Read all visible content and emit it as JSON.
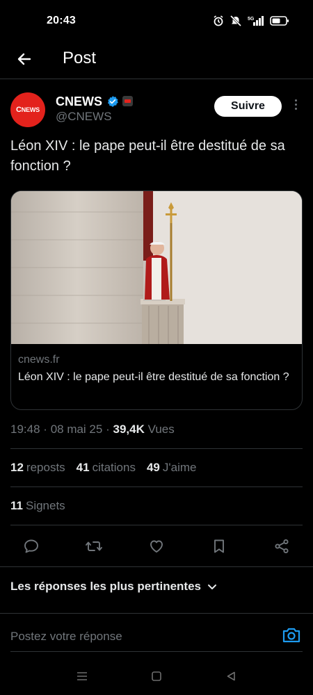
{
  "status_bar": {
    "time": "20:43",
    "network": "5G"
  },
  "header": {
    "title": "Post"
  },
  "author": {
    "name": "CNEWS",
    "handle": "@CNEWS",
    "avatar_text": "NEWS",
    "avatar_letter": "C",
    "verified": true,
    "follow_label": "Suivre"
  },
  "tweet": {
    "text": "Léon XIV : le pape peut-il être destitué de sa fonction ?"
  },
  "card": {
    "domain": "cnews.fr",
    "title": "Léon XIV : le pape peut-il être destitué de sa fonction ?"
  },
  "meta": {
    "time": "19:48",
    "date": "08 mai 25",
    "views_count": "39,4K",
    "views_label": "Vues",
    "separator": "·"
  },
  "stats": {
    "reposts_count": "12",
    "reposts_label": "reposts",
    "quotes_count": "41",
    "quotes_label": "citations",
    "likes_count": "49",
    "likes_label": "J'aime",
    "bookmarks_count": "11",
    "bookmarks_label": "Signets"
  },
  "actions": [
    "reply-icon",
    "repost-icon",
    "like-icon",
    "bookmark-icon",
    "share-icon"
  ],
  "replies": {
    "sort_label": "Les réponses les plus pertinentes",
    "input_placeholder": "Postez votre réponse"
  },
  "colors": {
    "background": "#000000",
    "text_primary": "#e7e9ea",
    "text_secondary": "#71767b",
    "accent": "#1d9bf0",
    "brand_red": "#e3221c",
    "divider": "#2f3336"
  }
}
